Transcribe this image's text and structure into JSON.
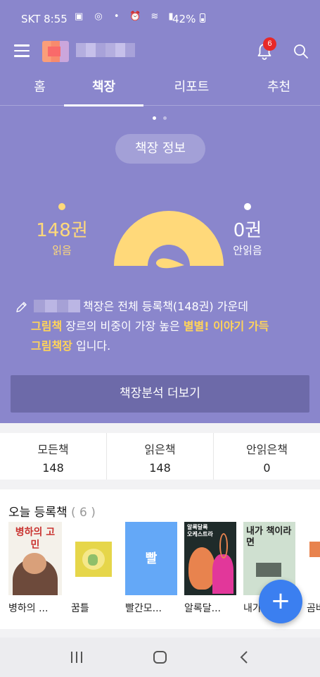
{
  "status_bar": {
    "carrier_time": "SKT 8:55",
    "left_icons": "▣ ◎ •",
    "right_icons": "⏰ ≋ ▮",
    "battery": "42%"
  },
  "app_bar": {
    "notification_count": "6"
  },
  "tabs": [
    {
      "label": "홈"
    },
    {
      "label": "책장"
    },
    {
      "label": "리포트"
    },
    {
      "label": "추천"
    }
  ],
  "active_tab": "책장",
  "shelf_info_label": "책장 정보",
  "stats": {
    "read_count": "148권",
    "read_label": "읽음",
    "unread_count": "0권",
    "unread_label": "안읽음",
    "read_fraction": 1.0
  },
  "summary": {
    "part1": "책장은 전체 등록책(148권) 가운데",
    "genre": "그림책",
    "part2": " 장르의 비중이 가장 높은 ",
    "shelf_name_a": "별별! 이야기 가득",
    "shelf_name_b": "그림책장",
    "part3": " 입니다."
  },
  "more_button": "책장분석 더보기",
  "counts": [
    {
      "label": "모든책",
      "value": "148"
    },
    {
      "label": "읽은책",
      "value": "148"
    },
    {
      "label": "안읽은책",
      "value": "0"
    }
  ],
  "today": {
    "title": "오늘 등록책",
    "count": "( 6 )",
    "books": [
      {
        "title": "병하의 ...",
        "cover_text": "병하의 고민"
      },
      {
        "title": "꿈틀",
        "cover_text": ""
      },
      {
        "title": "빨간모...",
        "cover_text": "빨"
      },
      {
        "title": "알록달...",
        "cover_text": "알록달록 오케스트라"
      },
      {
        "title": "내가...",
        "cover_text": "내가 책이라면"
      },
      {
        "title": "곰벼",
        "cover_text": ""
      }
    ]
  },
  "fab_label": "+",
  "colors": {
    "hero_bg": "#8a86cc",
    "highlight": "#ffd45a",
    "gauge": "#ffd97a",
    "fab": "#3b7ff0",
    "badge": "#e82828"
  }
}
